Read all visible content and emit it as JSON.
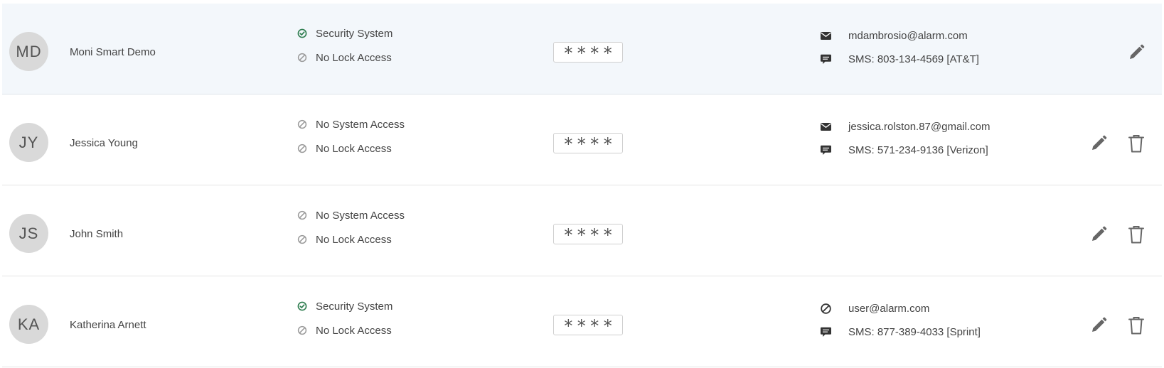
{
  "users": [
    {
      "initials": "MD",
      "name": "Moni Smart Demo",
      "system_access": {
        "label": "Security System",
        "granted": true
      },
      "lock_access": {
        "label": "No Lock Access",
        "granted": false
      },
      "pin_masked": "****",
      "email": {
        "text": "mdambrosio@alarm.com",
        "icon": "envelope-icon"
      },
      "sms": {
        "text": "SMS: 803-134-4569 [AT&T]",
        "icon": "chat-icon"
      },
      "can_delete": false,
      "selected": true
    },
    {
      "initials": "JY",
      "name": "Jessica Young",
      "system_access": {
        "label": "No System Access",
        "granted": false
      },
      "lock_access": {
        "label": "No Lock Access",
        "granted": false
      },
      "pin_masked": "****",
      "email": {
        "text": "jessica.rolston.87@gmail.com",
        "icon": "envelope-icon"
      },
      "sms": {
        "text": "SMS: 571-234-9136 [Verizon]",
        "icon": "chat-icon"
      },
      "can_delete": true,
      "selected": false
    },
    {
      "initials": "JS",
      "name": "John Smith",
      "system_access": {
        "label": "No System Access",
        "granted": false
      },
      "lock_access": {
        "label": "No Lock Access",
        "granted": false
      },
      "pin_masked": "****",
      "email": null,
      "sms": null,
      "can_delete": true,
      "selected": false
    },
    {
      "initials": "KA",
      "name": "Katherina Arnett",
      "system_access": {
        "label": "Security System",
        "granted": true
      },
      "lock_access": {
        "label": "No Lock Access",
        "granted": false
      },
      "pin_masked": "****",
      "email": {
        "text": "user@alarm.com",
        "icon": "blocked-icon"
      },
      "sms": {
        "text": "SMS: 877-389-4033 [Sprint]",
        "icon": "chat-icon"
      },
      "can_delete": true,
      "selected": false
    }
  ],
  "colors": {
    "granted": "#2e7d4f",
    "denied": "#9a9a9a",
    "icon_dark": "#333333",
    "action_icon": "#666666",
    "selected_row_bg": "#f3f7fb",
    "avatar_bg": "#d9d9d9"
  }
}
